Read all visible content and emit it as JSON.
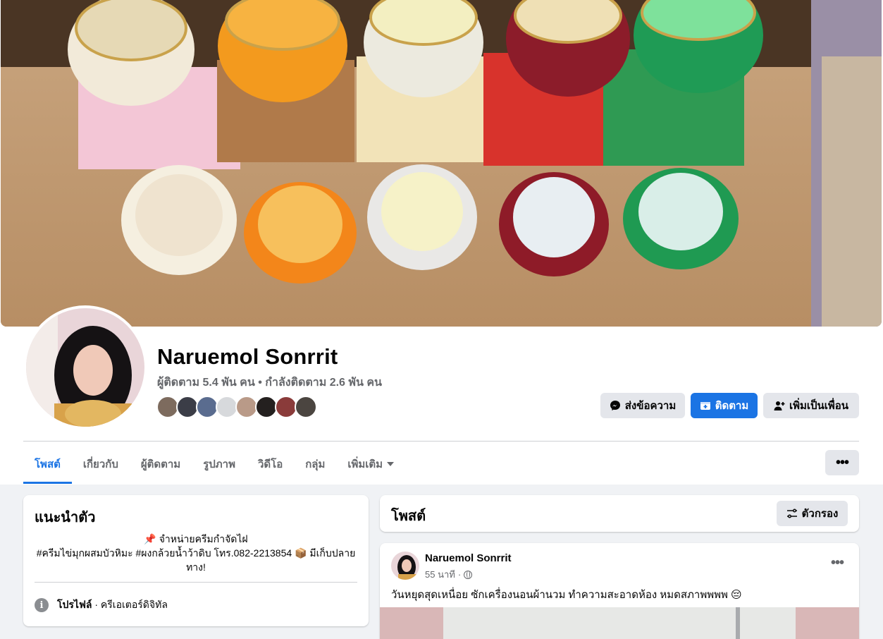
{
  "profile": {
    "name": "Naruemol Sonrrit",
    "stats": "ผู้ติดตาม 5.4 พัน คน • กำลังติดตาม 2.6 พัน คน",
    "friend_faces_count": 8
  },
  "actions": {
    "message_label": "ส่งข้อความ",
    "follow_label": "ติดตาม",
    "add_friend_label": "เพิ่มเป็นเพื่อน"
  },
  "tabs": [
    {
      "label": "โพสต์",
      "active": true
    },
    {
      "label": "เกี่ยวกับ",
      "active": false
    },
    {
      "label": "ผู้ติดตาม",
      "active": false
    },
    {
      "label": "รูปภาพ",
      "active": false
    },
    {
      "label": "วิดีโอ",
      "active": false
    },
    {
      "label": "กลุ่ม",
      "active": false
    },
    {
      "label": "เพิ่มเติม",
      "active": false
    }
  ],
  "intro": {
    "title": "แนะนำตัว",
    "bio_line1": "📌 จำหน่ายครีมกำจัดไฝ",
    "bio_line2": "#ครีมไข่มุกผสมบัวหิมะ #ผงกล้วยน้ำว้าดิบ โทร.082-2213854 📦 มีเก็บปลายทาง!",
    "profile_type_label": "โปรไฟล์",
    "profile_type_value": " · ครีเอเตอร์ดิจิทัล"
  },
  "posts": {
    "title": "โพสต์",
    "filter_label": "ตัวกรอง"
  },
  "post": {
    "author": "Naruemol Sonrrit",
    "time": "55 นาที",
    "text": "วันหยุดสุดเหนื่อย ซักเครื่องนอนผ้านวม ทำความสะอาดห้อง หมดสภาพพพพ 😔"
  },
  "colors": {
    "accent": "#1b74e4",
    "background": "#f0f2f5",
    "secondary_text": "#65676b"
  },
  "icons": {
    "message": "messenger-icon",
    "follow": "follow-icon",
    "add_friend": "add-friend-icon",
    "filter": "filter-icon",
    "info": "info-icon",
    "globe": "globe-icon"
  }
}
